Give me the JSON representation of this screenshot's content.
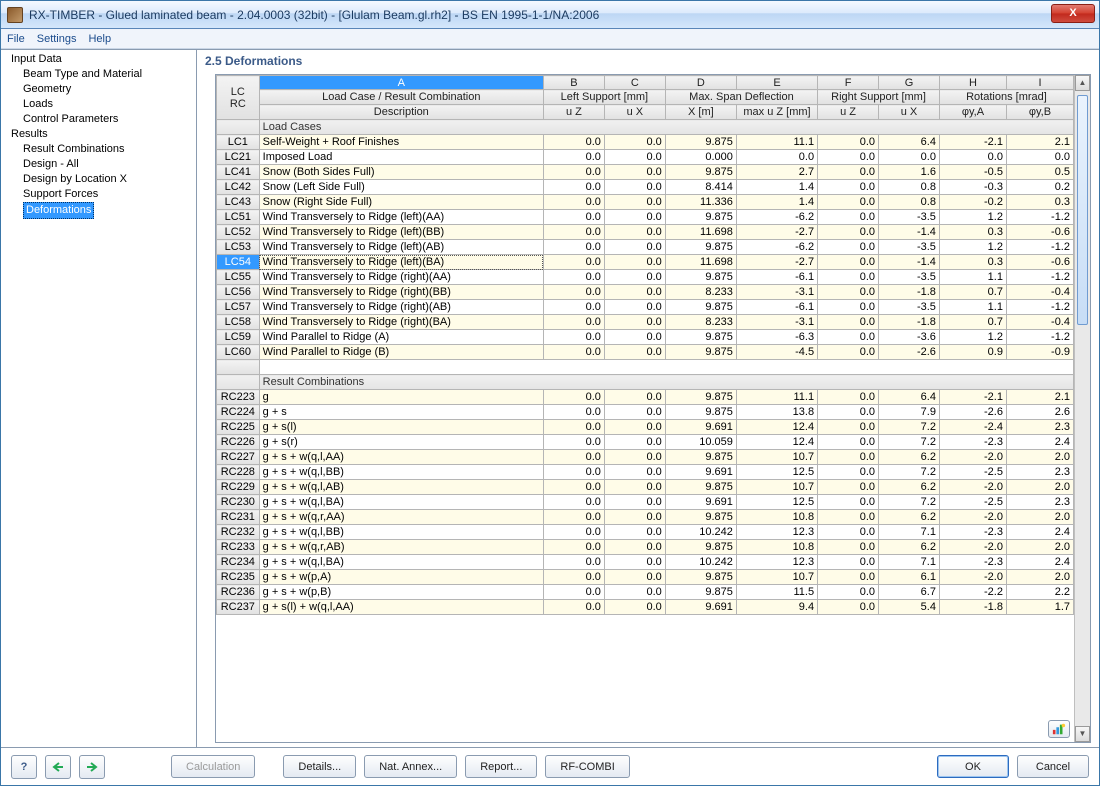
{
  "window": {
    "title": "RX-TIMBER - Glued laminated beam - 2.04.0003 (32bit) - [Glulam Beam.gl.rh2] - BS EN 1995-1-1/NA:2006",
    "close": "X"
  },
  "menu": {
    "file": "File",
    "settings": "Settings",
    "help": "Help"
  },
  "tree": {
    "input": "Input Data",
    "beam": "Beam Type and Material",
    "geometry": "Geometry",
    "loads": "Loads",
    "control": "Control Parameters",
    "results": "Results",
    "rc": "Result Combinations",
    "dall": "Design - All",
    "dloc": "Design by Location X",
    "sf": "Support Forces",
    "def": "Deformations"
  },
  "section_title": "2.5 Deformations",
  "hdr": {
    "lcrc1": "LC",
    "lcrc2": "RC",
    "loadcase1": "Load Case / Result Combination",
    "loadcase2": "Description",
    "left": "Left Support [mm]",
    "maxspan": "Max. Span Deflection",
    "right": "Right Support [mm]",
    "rot": "Rotations [mrad]",
    "uz": "u Z",
    "ux": "u X",
    "xm": "X [m]",
    "maxuz": "max u Z [mm]",
    "phiA": "φy,A",
    "phiB": "φy,B",
    "A": "A",
    "B": "B",
    "C": "C",
    "D": "D",
    "E": "E",
    "F": "F",
    "G": "G",
    "H": "H",
    "I": "I"
  },
  "group1": "Load Cases",
  "group2": "Result Combinations",
  "rows_lc": [
    {
      "id": "LC1",
      "desc": "Self-Weight + Roof Finishes",
      "b": "0.0",
      "c": "0.0",
      "d": "9.875",
      "e": "11.1",
      "f": "0.0",
      "g": "6.4",
      "h": "-2.1",
      "i": "2.1"
    },
    {
      "id": "LC21",
      "desc": "Imposed Load",
      "b": "0.0",
      "c": "0.0",
      "d": "0.000",
      "e": "0.0",
      "f": "0.0",
      "g": "0.0",
      "h": "0.0",
      "i": "0.0"
    },
    {
      "id": "LC41",
      "desc": "Snow (Both Sides Full)",
      "b": "0.0",
      "c": "0.0",
      "d": "9.875",
      "e": "2.7",
      "f": "0.0",
      "g": "1.6",
      "h": "-0.5",
      "i": "0.5"
    },
    {
      "id": "LC42",
      "desc": "Snow (Left Side Full)",
      "b": "0.0",
      "c": "0.0",
      "d": "8.414",
      "e": "1.4",
      "f": "0.0",
      "g": "0.8",
      "h": "-0.3",
      "i": "0.2"
    },
    {
      "id": "LC43",
      "desc": "Snow (Right Side Full)",
      "b": "0.0",
      "c": "0.0",
      "d": "11.336",
      "e": "1.4",
      "f": "0.0",
      "g": "0.8",
      "h": "-0.2",
      "i": "0.3"
    },
    {
      "id": "LC51",
      "desc": "Wind Transversely to Ridge (left)(AA)",
      "b": "0.0",
      "c": "0.0",
      "d": "9.875",
      "e": "-6.2",
      "f": "0.0",
      "g": "-3.5",
      "h": "1.2",
      "i": "-1.2"
    },
    {
      "id": "LC52",
      "desc": "Wind Transversely to Ridge (left)(BB)",
      "b": "0.0",
      "c": "0.0",
      "d": "11.698",
      "e": "-2.7",
      "f": "0.0",
      "g": "-1.4",
      "h": "0.3",
      "i": "-0.6"
    },
    {
      "id": "LC53",
      "desc": "Wind Transversely to Ridge (left)(AB)",
      "b": "0.0",
      "c": "0.0",
      "d": "9.875",
      "e": "-6.2",
      "f": "0.0",
      "g": "-3.5",
      "h": "1.2",
      "i": "-1.2"
    },
    {
      "id": "LC54",
      "desc": "Wind Transversely to Ridge (left)(BA)",
      "b": "0.0",
      "c": "0.0",
      "d": "11.698",
      "e": "-2.7",
      "f": "0.0",
      "g": "-1.4",
      "h": "0.3",
      "i": "-0.6",
      "sel": true
    },
    {
      "id": "LC55",
      "desc": "Wind Transversely to Ridge (right)(AA)",
      "b": "0.0",
      "c": "0.0",
      "d": "9.875",
      "e": "-6.1",
      "f": "0.0",
      "g": "-3.5",
      "h": "1.1",
      "i": "-1.2"
    },
    {
      "id": "LC56",
      "desc": "Wind Transversely to Ridge (right)(BB)",
      "b": "0.0",
      "c": "0.0",
      "d": "8.233",
      "e": "-3.1",
      "f": "0.0",
      "g": "-1.8",
      "h": "0.7",
      "i": "-0.4"
    },
    {
      "id": "LC57",
      "desc": "Wind Transversely to Ridge (right)(AB)",
      "b": "0.0",
      "c": "0.0",
      "d": "9.875",
      "e": "-6.1",
      "f": "0.0",
      "g": "-3.5",
      "h": "1.1",
      "i": "-1.2"
    },
    {
      "id": "LC58",
      "desc": "Wind Transversely to Ridge (right)(BA)",
      "b": "0.0",
      "c": "0.0",
      "d": "8.233",
      "e": "-3.1",
      "f": "0.0",
      "g": "-1.8",
      "h": "0.7",
      "i": "-0.4"
    },
    {
      "id": "LC59",
      "desc": "Wind Parallel to Ridge (A)",
      "b": "0.0",
      "c": "0.0",
      "d": "9.875",
      "e": "-6.3",
      "f": "0.0",
      "g": "-3.6",
      "h": "1.2",
      "i": "-1.2"
    },
    {
      "id": "LC60",
      "desc": "Wind Parallel to Ridge (B)",
      "b": "0.0",
      "c": "0.0",
      "d": "9.875",
      "e": "-4.5",
      "f": "0.0",
      "g": "-2.6",
      "h": "0.9",
      "i": "-0.9"
    }
  ],
  "rows_rc": [
    {
      "id": "RC223",
      "desc": "g",
      "b": "0.0",
      "c": "0.0",
      "d": "9.875",
      "e": "11.1",
      "f": "0.0",
      "g": "6.4",
      "h": "-2.1",
      "i": "2.1"
    },
    {
      "id": "RC224",
      "desc": "g + s",
      "b": "0.0",
      "c": "0.0",
      "d": "9.875",
      "e": "13.8",
      "f": "0.0",
      "g": "7.9",
      "h": "-2.6",
      "i": "2.6"
    },
    {
      "id": "RC225",
      "desc": "g + s(l)",
      "b": "0.0",
      "c": "0.0",
      "d": "9.691",
      "e": "12.4",
      "f": "0.0",
      "g": "7.2",
      "h": "-2.4",
      "i": "2.3"
    },
    {
      "id": "RC226",
      "desc": "g + s(r)",
      "b": "0.0",
      "c": "0.0",
      "d": "10.059",
      "e": "12.4",
      "f": "0.0",
      "g": "7.2",
      "h": "-2.3",
      "i": "2.4"
    },
    {
      "id": "RC227",
      "desc": "g + s + w(q,l,AA)",
      "b": "0.0",
      "c": "0.0",
      "d": "9.875",
      "e": "10.7",
      "f": "0.0",
      "g": "6.2",
      "h": "-2.0",
      "i": "2.0"
    },
    {
      "id": "RC228",
      "desc": "g + s + w(q,l,BB)",
      "b": "0.0",
      "c": "0.0",
      "d": "9.691",
      "e": "12.5",
      "f": "0.0",
      "g": "7.2",
      "h": "-2.5",
      "i": "2.3"
    },
    {
      "id": "RC229",
      "desc": "g + s + w(q,l,AB)",
      "b": "0.0",
      "c": "0.0",
      "d": "9.875",
      "e": "10.7",
      "f": "0.0",
      "g": "6.2",
      "h": "-2.0",
      "i": "2.0"
    },
    {
      "id": "RC230",
      "desc": "g + s + w(q,l,BA)",
      "b": "0.0",
      "c": "0.0",
      "d": "9.691",
      "e": "12.5",
      "f": "0.0",
      "g": "7.2",
      "h": "-2.5",
      "i": "2.3"
    },
    {
      "id": "RC231",
      "desc": "g + s + w(q,r,AA)",
      "b": "0.0",
      "c": "0.0",
      "d": "9.875",
      "e": "10.8",
      "f": "0.0",
      "g": "6.2",
      "h": "-2.0",
      "i": "2.0"
    },
    {
      "id": "RC232",
      "desc": "g + s + w(q,l,BB)",
      "b": "0.0",
      "c": "0.0",
      "d": "10.242",
      "e": "12.3",
      "f": "0.0",
      "g": "7.1",
      "h": "-2.3",
      "i": "2.4"
    },
    {
      "id": "RC233",
      "desc": "g + s + w(q,r,AB)",
      "b": "0.0",
      "c": "0.0",
      "d": "9.875",
      "e": "10.8",
      "f": "0.0",
      "g": "6.2",
      "h": "-2.0",
      "i": "2.0"
    },
    {
      "id": "RC234",
      "desc": "g + s + w(q,l,BA)",
      "b": "0.0",
      "c": "0.0",
      "d": "10.242",
      "e": "12.3",
      "f": "0.0",
      "g": "7.1",
      "h": "-2.3",
      "i": "2.4"
    },
    {
      "id": "RC235",
      "desc": "g + s + w(p,A)",
      "b": "0.0",
      "c": "0.0",
      "d": "9.875",
      "e": "10.7",
      "f": "0.0",
      "g": "6.1",
      "h": "-2.0",
      "i": "2.0"
    },
    {
      "id": "RC236",
      "desc": "g + s + w(p,B)",
      "b": "0.0",
      "c": "0.0",
      "d": "9.875",
      "e": "11.5",
      "f": "0.0",
      "g": "6.7",
      "h": "-2.2",
      "i": "2.2"
    },
    {
      "id": "RC237",
      "desc": "g + s(l) + w(q,l,AA)",
      "b": "0.0",
      "c": "0.0",
      "d": "9.691",
      "e": "9.4",
      "f": "0.0",
      "g": "5.4",
      "h": "-1.8",
      "i": "1.7"
    }
  ],
  "footer": {
    "calc": "Calculation",
    "details": "Details...",
    "annex": "Nat. Annex...",
    "report": "Report...",
    "rfcombi": "RF-COMBI",
    "ok": "OK",
    "cancel": "Cancel"
  }
}
